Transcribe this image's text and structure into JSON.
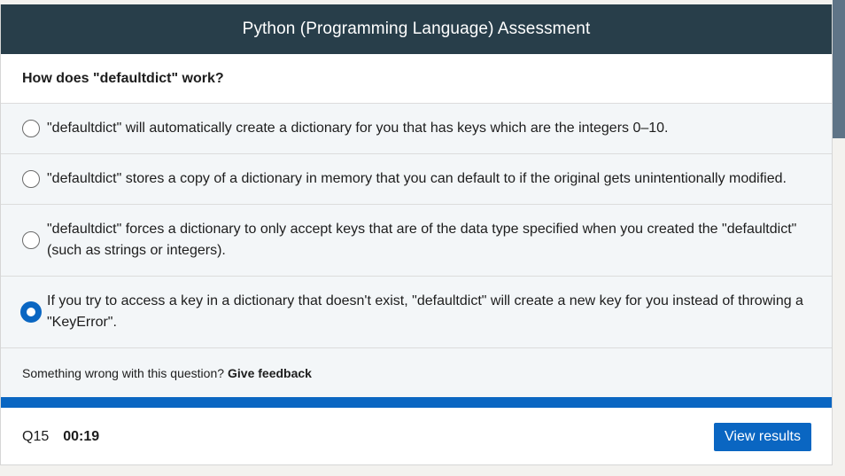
{
  "header": {
    "title": "Python (Programming Language) Assessment"
  },
  "question": {
    "text": "How does \"defaultdict\" work?"
  },
  "options": [
    {
      "text": "\"defaultdict\" will automatically create a dictionary for you that has keys which are the integers 0–10.",
      "selected": false
    },
    {
      "text": "\"defaultdict\" stores a copy of a dictionary in memory that you can default to if the original gets unintentionally modified.",
      "selected": false
    },
    {
      "text": "\"defaultdict\" forces a dictionary to only accept keys that are of the data type specified when you created the \"defaultdict\" (such as strings or integers).",
      "selected": false
    },
    {
      "text": "If you try to access a key in a dictionary that doesn't exist, \"defaultdict\" will create a new key for you instead of throwing a \"KeyError\".",
      "selected": true
    }
  ],
  "feedback": {
    "prompt": "Something wrong with this question?",
    "link": "Give feedback"
  },
  "footer": {
    "question_number": "Q15",
    "timer": "00:19",
    "view_results_label": "View results"
  },
  "colors": {
    "header_bg": "#283e4a",
    "accent": "#0a66c2",
    "option_bg": "#f3f6f8"
  }
}
